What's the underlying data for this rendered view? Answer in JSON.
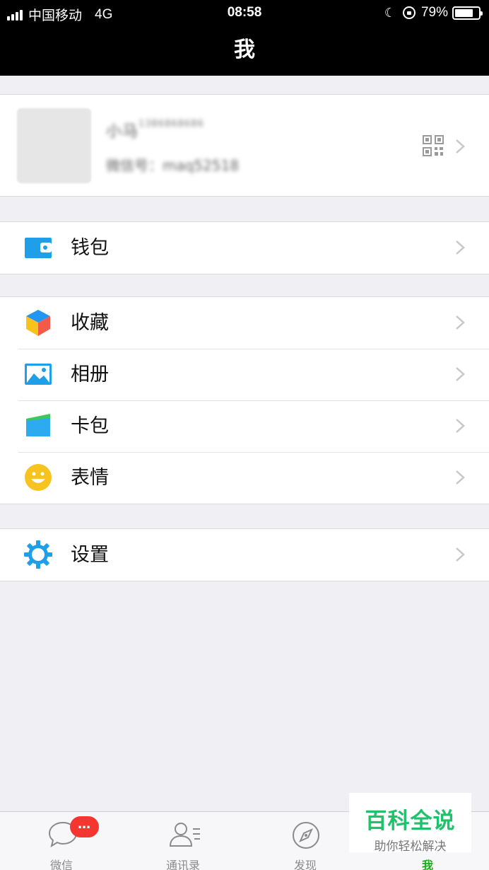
{
  "status_bar": {
    "carrier": "中国移动",
    "network": "4G",
    "time": "08:58",
    "battery": "79%",
    "battery_level": 0.79
  },
  "nav": {
    "title": "我"
  },
  "profile": {
    "name": "小马",
    "phone_hint": "1386868686",
    "id_label": "微信号：",
    "id_value": "maq52518"
  },
  "menu": {
    "wallet": {
      "label": "钱包",
      "icon": "wallet-icon"
    },
    "favorites": {
      "label": "收藏",
      "icon": "cube-icon"
    },
    "album": {
      "label": "相册",
      "icon": "album-icon"
    },
    "cards": {
      "label": "卡包",
      "icon": "card-icon"
    },
    "stickers": {
      "label": "表情",
      "icon": "smiley-icon"
    },
    "settings": {
      "label": "设置",
      "icon": "gear-icon"
    }
  },
  "tabs": [
    {
      "label": "微信",
      "icon": "chat-bubble-icon"
    },
    {
      "label": "通讯录",
      "icon": "contacts-icon"
    },
    {
      "label": "发现",
      "icon": "compass-icon"
    },
    {
      "label": "我",
      "icon": "person-icon"
    }
  ],
  "badge": "…",
  "watermark": {
    "title": "百科全说",
    "subtitle": "助你轻松解决"
  },
  "colors": {
    "accent_green": "#1aad19",
    "badge_red": "#f43530",
    "background": "#efeff4",
    "watermark_green": "#1fc16b"
  }
}
